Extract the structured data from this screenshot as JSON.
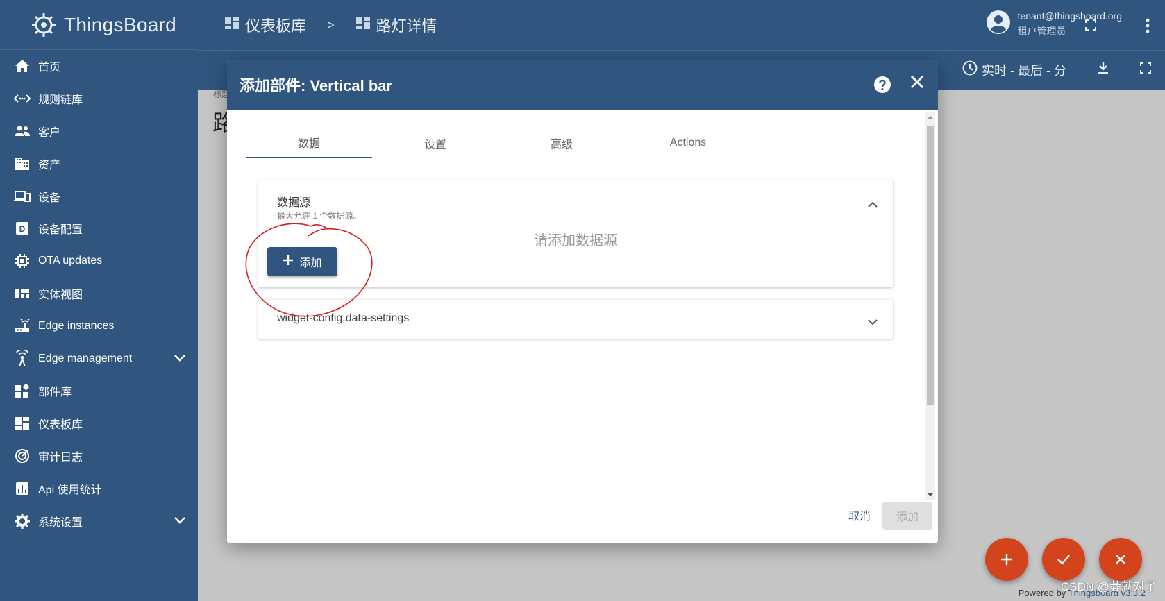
{
  "sidebar": {
    "logo_text": "ThingsBoard",
    "items": [
      {
        "label": "首页",
        "icon": "home-icon"
      },
      {
        "label": "规则链库",
        "icon": "code-arrows-icon"
      },
      {
        "label": "客户",
        "icon": "people-icon"
      },
      {
        "label": "资产",
        "icon": "building-icon"
      },
      {
        "label": "设备",
        "icon": "devices-icon"
      },
      {
        "label": "设备配置",
        "icon": "device-profile-icon"
      },
      {
        "label": "OTA updates",
        "icon": "chip-icon"
      },
      {
        "label": "实体视图",
        "icon": "view-quilt-icon"
      },
      {
        "label": "Edge instances",
        "icon": "router-icon"
      },
      {
        "label": "Edge management",
        "icon": "antenna-icon"
      },
      {
        "label": "部件库",
        "icon": "widgets-icon"
      },
      {
        "label": "仪表板库",
        "icon": "dashboard-icon"
      },
      {
        "label": "审计日志",
        "icon": "track-changes-icon"
      },
      {
        "label": "Api 使用统计",
        "icon": "chart-icon"
      },
      {
        "label": "系统设置",
        "icon": "gear-icon"
      }
    ]
  },
  "header": {
    "breadcrumb_1": "仪表板库",
    "breadcrumb_sep": ">",
    "breadcrumb_2": "路灯详情",
    "user_email": "tenant@thingsboard.org",
    "user_role": "租户管理员"
  },
  "toolbar": {
    "timewindow": "实时 - 最后 - 分"
  },
  "background": {
    "crumb": "标题",
    "title": "路"
  },
  "dialog": {
    "title": "添加部件: Vertical bar",
    "tabs": [
      "数据",
      "设置",
      "高级",
      "Actions"
    ],
    "datasource": {
      "title": "数据源",
      "subtitle": "最大允许 1 个数据源。",
      "empty": "请添加数据源",
      "add_label": "添加"
    },
    "data_settings_title": "widget-config.data-settings",
    "cancel_label": "取消",
    "ok_label": "添加"
  },
  "footer": {
    "powered_by": "Powered by",
    "link": "Thingsboard v3.3.2",
    "watermark": "CSDN @莽就对了"
  },
  "colors": {
    "primary": "#305680",
    "fab": "#d4441c",
    "annotation": "#d42020"
  }
}
